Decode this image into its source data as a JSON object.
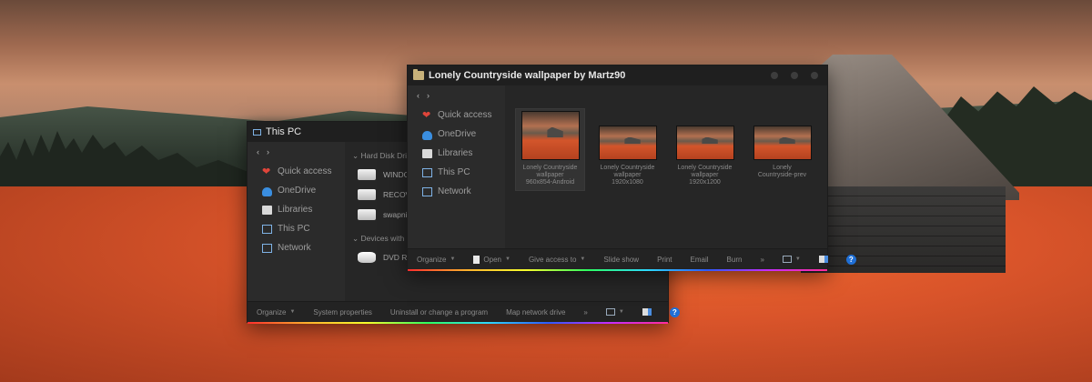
{
  "pc_window": {
    "title": "This PC",
    "nav": {
      "back": "‹",
      "forward": "›"
    },
    "sidebar": [
      {
        "label": "Quick access",
        "icon": "heart-icon"
      },
      {
        "label": "OneDrive",
        "icon": "cloud-icon"
      },
      {
        "label": "Libraries",
        "icon": "library-icon"
      },
      {
        "label": "This PC",
        "icon": "computer-icon"
      },
      {
        "label": "Network",
        "icon": "network-icon"
      }
    ],
    "groups": {
      "hard_disk": "Hard Disk Driv",
      "devices": "Devices with R"
    },
    "drives": [
      "WINDO",
      "RECOVE",
      "swapni"
    ],
    "dvd": "DVD RW Drive (E:)",
    "toolbar": {
      "organize": "Organize",
      "system_properties": "System properties",
      "uninstall": "Uninstall or change a program",
      "map_drive": "Map network drive",
      "more": "»",
      "help": "?"
    }
  },
  "lc_window": {
    "title": "Lonely Countryside wallpaper by Martz90",
    "nav": {
      "back": "‹",
      "forward": "›"
    },
    "sidebar": [
      {
        "label": "Quick access",
        "icon": "heart-icon"
      },
      {
        "label": "OneDrive",
        "icon": "cloud-icon"
      },
      {
        "label": "Libraries",
        "icon": "library-icon"
      },
      {
        "label": "This PC",
        "icon": "computer-icon"
      },
      {
        "label": "Network",
        "icon": "network-icon"
      }
    ],
    "files": [
      {
        "line1": "Lonely Countryside",
        "line2": "wallpaper",
        "line3": "960x854-Android",
        "selected": true
      },
      {
        "line1": "Lonely Countryside",
        "line2": "wallpaper",
        "line3": "1920x1080",
        "selected": false
      },
      {
        "line1": "Lonely Countryside",
        "line2": "wallpaper",
        "line3": "1920x1200",
        "selected": false
      },
      {
        "line1": "Lonely",
        "line2": "Countryside-prev",
        "line3": "",
        "selected": false
      }
    ],
    "toolbar": {
      "organize": "Organize",
      "open": "Open",
      "give_access": "Give access to",
      "slide_show": "Slide show",
      "print": "Print",
      "email": "Email",
      "burn": "Burn",
      "more": "»",
      "help": "?"
    }
  },
  "colors": {
    "window_bg": "#2b2b2b",
    "titlebar_bg": "#1f1f1f",
    "accent_blue": "#1f6fd6",
    "heart_red": "#e0453a"
  }
}
